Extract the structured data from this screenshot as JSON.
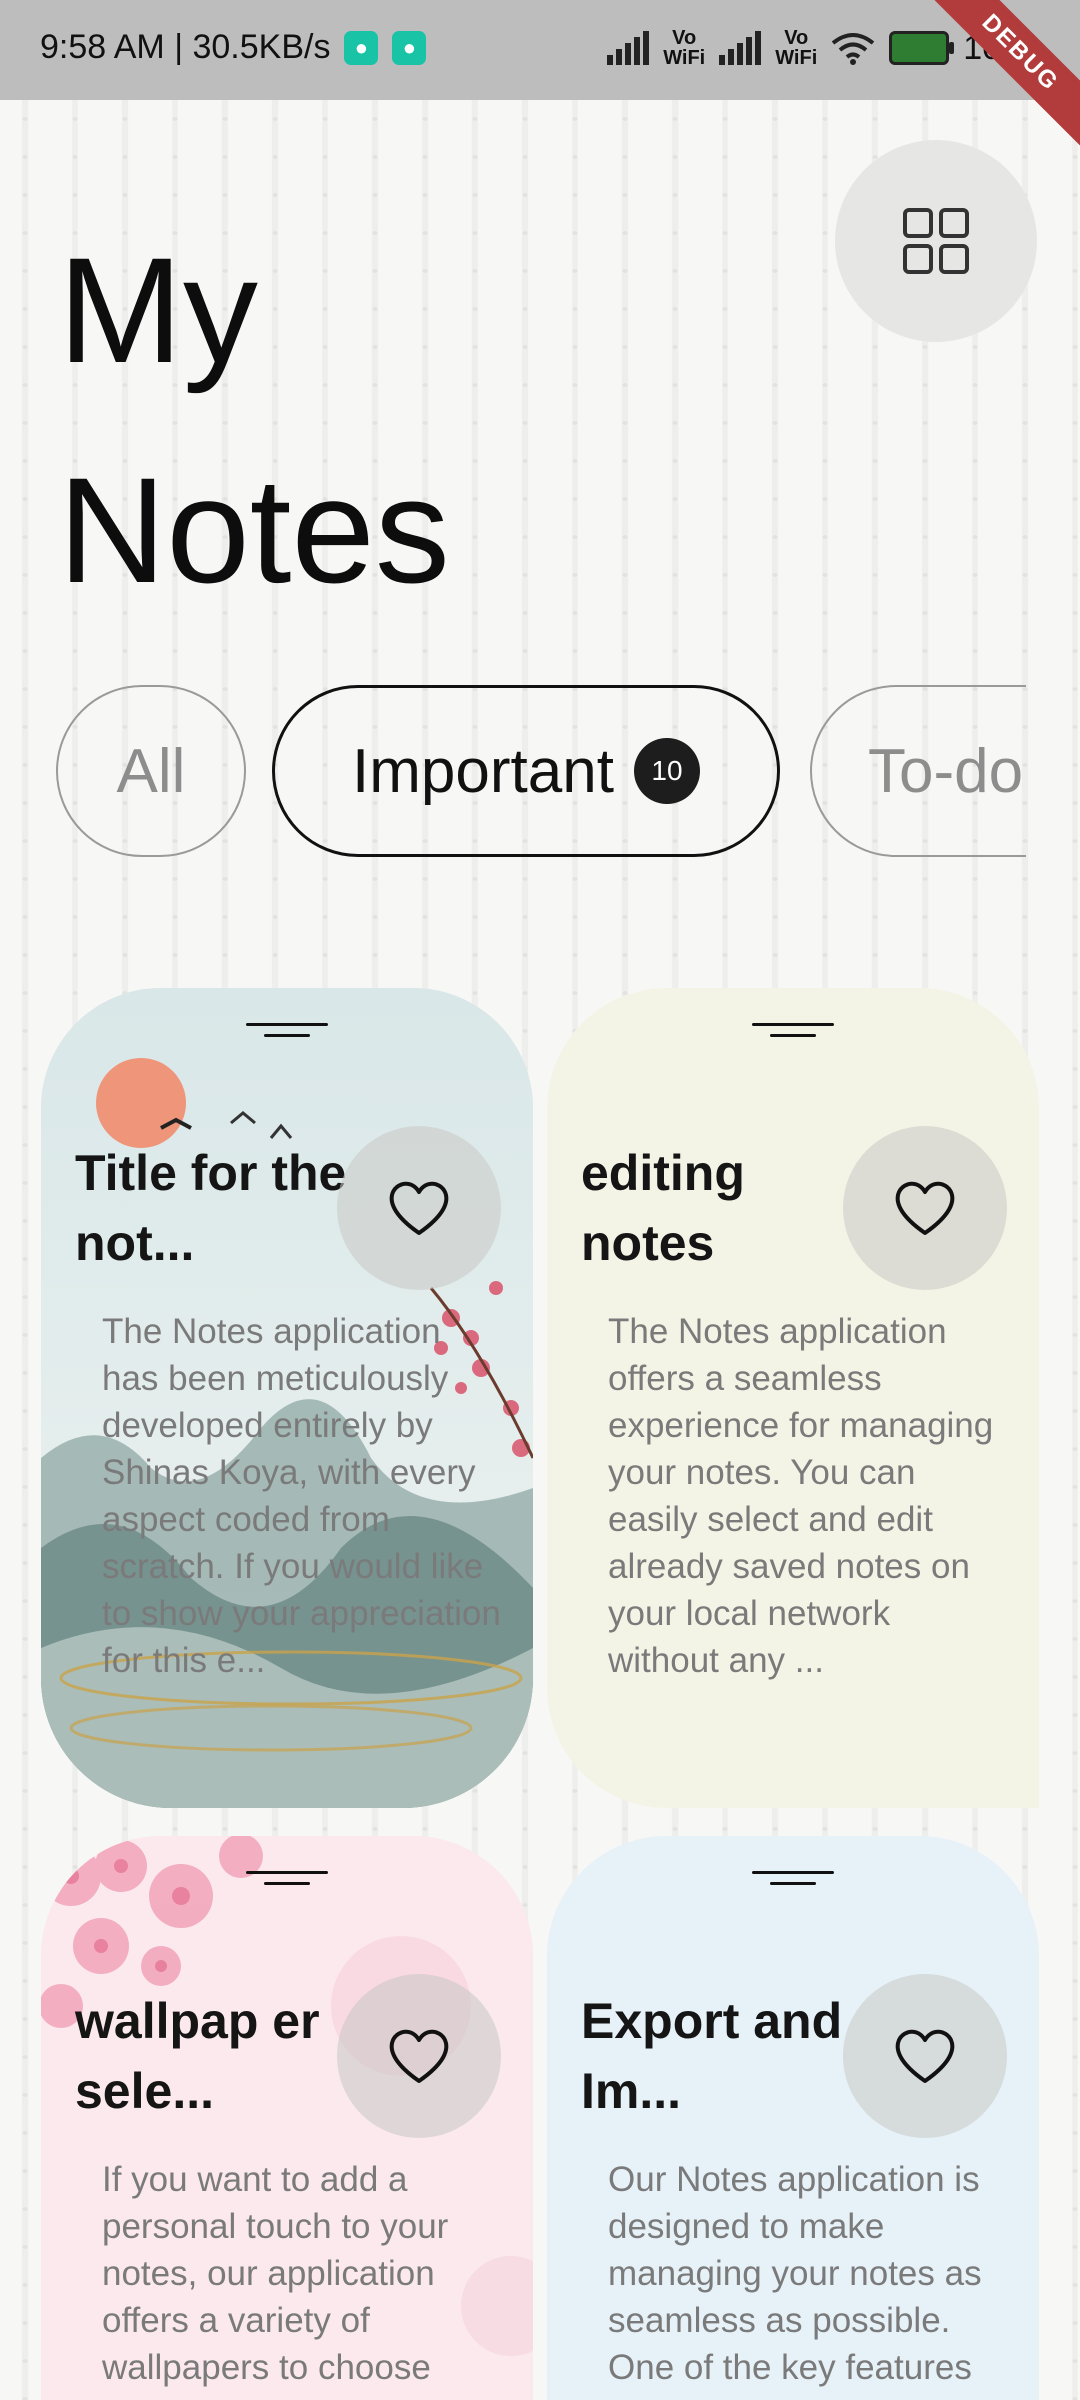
{
  "status_bar": {
    "time_speed": "9:58 AM | 30.5KB/s",
    "vo1": "Vo",
    "wifi1": "WiFi",
    "vo2": "Vo",
    "wifi2": "WiFi",
    "battery": "100",
    "debug_label": "DEBUG"
  },
  "header": {
    "title": "My Notes"
  },
  "filters": {
    "items": [
      {
        "label": "All"
      },
      {
        "label": "Important",
        "badge": "10"
      },
      {
        "label": "To-do"
      }
    ],
    "selected": "Important"
  },
  "notes": [
    {
      "title": "Title for the not...",
      "body": "The Notes application has been meticulously developed entirely by Shinas Koya, with every aspect coded from scratch. If you would like to show your appreciation for this e...",
      "wallpaper": "mountain-ink-painting",
      "bg_color": "#dfe9ea"
    },
    {
      "title": "editing notes",
      "body": "The Notes application offers a seamless experience for managing your notes. You can easily select and edit already saved notes on your local network without any ...",
      "wallpaper": "none",
      "bg_color": "#f4f4e6"
    },
    {
      "title": "wallpap er sele...",
      "body": "If you want to add a personal touch to your notes, our application offers a variety of wallpapers to choose",
      "wallpaper": "cherry-blossom",
      "bg_color": "#fbe7ec"
    },
    {
      "title": "Export and Im...",
      "body": "Our Notes application is designed to make managing your notes as seamless as possible. One of the key features",
      "wallpaper": "none",
      "bg_color": "#e6f1f8"
    }
  ],
  "icons": {
    "grid": "grid-view-icon",
    "favorite": "heart-outline-icon",
    "handle": "drag-handle-icon"
  }
}
